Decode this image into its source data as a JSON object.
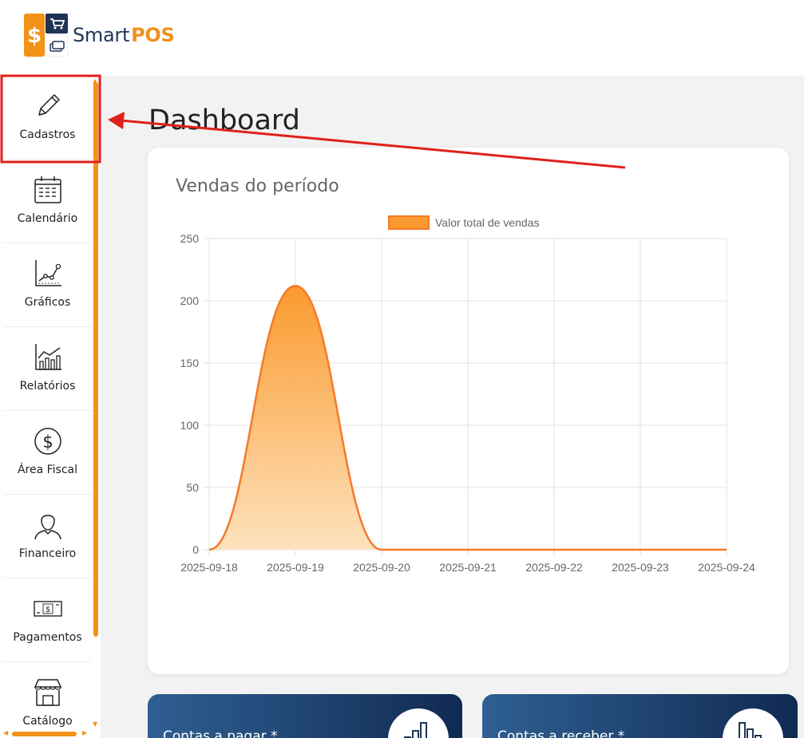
{
  "brand": {
    "name_part1": "Smart",
    "name_part2": "POS",
    "icon": "dollar-cart-logo-icon",
    "accent_color": "#f0901d",
    "navy_color": "#1e3556"
  },
  "sidebar": {
    "items": [
      {
        "label": "Cadastros",
        "icon": "pencil-icon"
      },
      {
        "label": "Calendário",
        "icon": "calendar-icon"
      },
      {
        "label": "Gráficos",
        "icon": "line-chart-icon"
      },
      {
        "label": "Relatórios",
        "icon": "bar-chart-icon"
      },
      {
        "label": "Área Fiscal",
        "icon": "dollar-circle-icon"
      },
      {
        "label": "Financeiro",
        "icon": "person-icon"
      },
      {
        "label": "Pagamentos",
        "icon": "banknote-icon"
      },
      {
        "label": "Catálogo",
        "icon": "storefront-icon"
      }
    ]
  },
  "page": {
    "title": "Dashboard"
  },
  "chart_card": {
    "title": "Vendas do período"
  },
  "chart_data": {
    "type": "area",
    "title": "Vendas do período",
    "x": [
      "2025-09-18",
      "2025-09-19",
      "2025-09-20",
      "2025-09-21",
      "2025-09-22",
      "2025-09-23",
      "2025-09-24"
    ],
    "series": [
      {
        "name": "Valor total de vendas",
        "values": [
          0,
          212,
          0,
          0,
          0,
          0,
          0
        ],
        "color": "#f57a2a",
        "fill_top": "#fa9a2e",
        "fill_bottom": "#fde2bd"
      }
    ],
    "ylim": [
      0,
      250
    ],
    "yticks": [
      "0",
      "50",
      "100",
      "150",
      "200",
      "250"
    ],
    "grid": true,
    "legend": "top-center",
    "smooth": true
  },
  "kpi_cards": [
    {
      "title": "Contas a pagar *",
      "icon": "bar-chart-up-icon"
    },
    {
      "title": "Contas a receber *",
      "icon": "bar-chart-down-icon"
    }
  ],
  "annotation": {
    "color": "#e0201c"
  }
}
